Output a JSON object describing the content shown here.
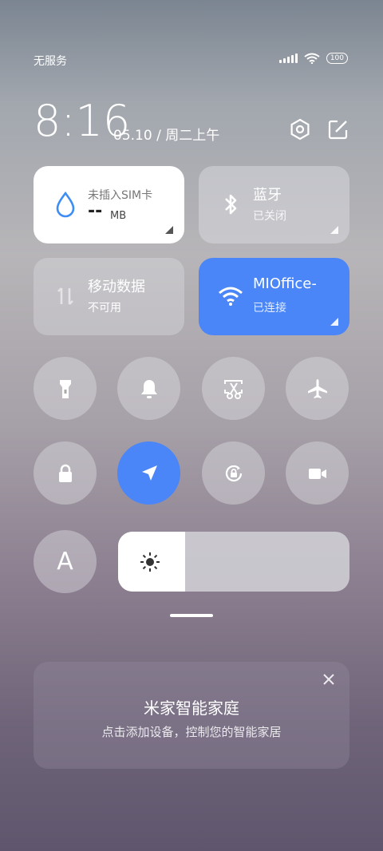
{
  "status": {
    "carrier": "无服务",
    "battery": "100"
  },
  "clock": {
    "time": "8:16",
    "date": "05.10 / 周二上午"
  },
  "tiles": {
    "data_usage": {
      "label": "未插入SIM卡",
      "value": "--",
      "unit": "MB"
    },
    "bluetooth": {
      "label": "蓝牙",
      "status": "已关闭"
    },
    "mobile_data": {
      "label": "移动数据",
      "status": "不可用"
    },
    "wifi": {
      "label": "MIOffice-",
      "status": "已连接"
    }
  },
  "toggles_row1": [
    "flashlight-icon",
    "bell-icon",
    "screenshot-icon",
    "airplane-icon"
  ],
  "toggles_row2": [
    "lock-icon",
    "location-icon",
    "rotation-lock-icon",
    "video-icon"
  ],
  "brightness": {
    "level": 0.29,
    "auto_label": "A"
  },
  "smart_home_card": {
    "title": "米家智能家庭",
    "subtitle": "点击添加设备，控制您的智能家居"
  },
  "colors": {
    "accent": "#4a86f7",
    "tile_white": "#ffffff"
  }
}
